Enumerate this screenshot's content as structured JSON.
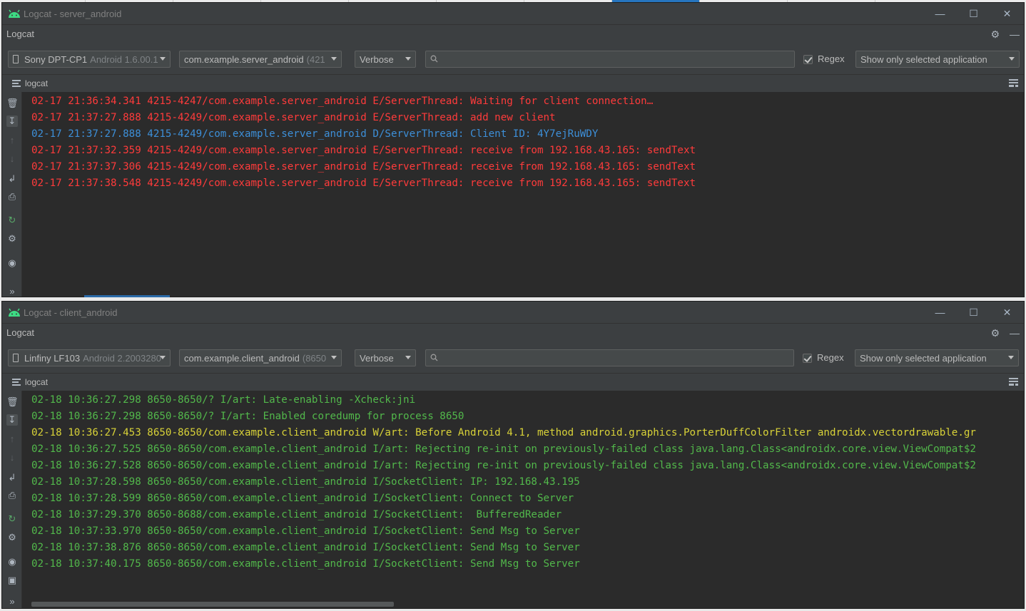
{
  "server": {
    "window_title": "Logcat - server_android",
    "panel_title": "Logcat",
    "device": {
      "name": "Sony DPT-CP1",
      "sub": "Android 1.6.00.1"
    },
    "process": {
      "name": "com.example.server_android",
      "sub": "(421"
    },
    "level": "Verbose",
    "search_placeholder": "",
    "regex_label": "Regex",
    "filter": "Show only selected application",
    "tab_label": "logcat",
    "lines": [
      {
        "level": "E",
        "text": "02-17 21:36:34.341 4215-4247/com.example.server_android E/ServerThread: Waiting for client connection…"
      },
      {
        "level": "E",
        "text": "02-17 21:37:27.888 4215-4249/com.example.server_android E/ServerThread: add new client"
      },
      {
        "level": "D",
        "text": "02-17 21:37:27.888 4215-4249/com.example.server_android D/ServerThread: Client ID: 4Y7ejRuWDY"
      },
      {
        "level": "E",
        "text": "02-17 21:37:32.359 4215-4249/com.example.server_android E/ServerThread: receive from 192.168.43.165: sendText"
      },
      {
        "level": "E",
        "text": "02-17 21:37:37.306 4215-4249/com.example.server_android E/ServerThread: receive from 192.168.43.165: sendText"
      },
      {
        "level": "E",
        "text": "02-17 21:37:38.548 4215-4249/com.example.server_android E/ServerThread: receive from 192.168.43.165: sendText"
      }
    ]
  },
  "client": {
    "window_title": "Logcat - client_android",
    "panel_title": "Logcat",
    "device": {
      "name": "Linfiny LF103",
      "sub": "Android 2.2003280"
    },
    "process": {
      "name": "com.example.client_android",
      "sub": "(8650"
    },
    "level": "Verbose",
    "search_placeholder": "",
    "regex_label": "Regex",
    "filter": "Show only selected application",
    "tab_label": "logcat",
    "lines": [
      {
        "level": "I",
        "text": "02-18 10:36:27.298 8650-8650/? I/art: Late-enabling -Xcheck:jni"
      },
      {
        "level": "I",
        "text": "02-18 10:36:27.298 8650-8650/? I/art: Enabled coredump for process 8650"
      },
      {
        "level": "W",
        "text": "02-18 10:36:27.453 8650-8650/com.example.client_android W/art: Before Android 4.1, method android.graphics.PorterDuffColorFilter androidx.vectordrawable.gr"
      },
      {
        "level": "I",
        "text": "02-18 10:36:27.525 8650-8650/com.example.client_android I/art: Rejecting re-init on previously-failed class java.lang.Class<androidx.core.view.ViewCompat$2"
      },
      {
        "level": "I",
        "text": "02-18 10:36:27.528 8650-8650/com.example.client_android I/art: Rejecting re-init on previously-failed class java.lang.Class<androidx.core.view.ViewCompat$2"
      },
      {
        "level": "I",
        "text": "02-18 10:37:28.598 8650-8650/com.example.client_android I/SocketClient: IP: 192.168.43.195"
      },
      {
        "level": "I",
        "text": "02-18 10:37:28.599 8650-8650/com.example.client_android I/SocketClient: Connect to Server"
      },
      {
        "level": "I",
        "text": "02-18 10:37:29.370 8650-8688/com.example.client_android I/SocketClient:  BufferedReader"
      },
      {
        "level": "I",
        "text": "02-18 10:37:33.970 8650-8650/com.example.client_android I/SocketClient: Send Msg to Server"
      },
      {
        "level": "I",
        "text": "02-18 10:37:38.876 8650-8650/com.example.client_android I/SocketClient: Send Msg to Server"
      },
      {
        "level": "I",
        "text": "02-18 10:37:40.175 8650-8650/com.example.client_android I/SocketClient: Send Msg to Server"
      }
    ]
  },
  "colors": {
    "error": "#ff3b3b",
    "debug": "#3d8fd8",
    "info": "#52b84b",
    "warn": "#d8d238",
    "android_green": "#3ddc84"
  },
  "icons": {
    "gutter": [
      "trash-icon",
      "scroll-to-end-icon",
      "up-icon",
      "down-icon",
      "soft-wrap-icon",
      "print-icon",
      "restart-icon",
      "settings-icon",
      "camera-icon",
      "video-icon",
      "more-icon"
    ],
    "header": [
      "gear-icon",
      "minimize-panel-icon"
    ]
  }
}
